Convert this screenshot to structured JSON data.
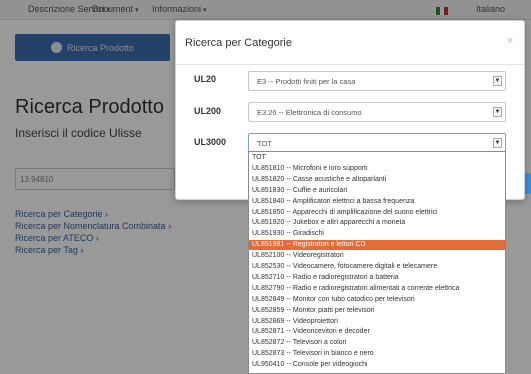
{
  "navbar": {
    "menu_items": [
      "Descrizione Servizi",
      "Document",
      "Informazioni"
    ],
    "language_label": "Italiano",
    "flag_colors": [
      "#2e8b3a",
      "#ffffff",
      "#cf2f2f"
    ]
  },
  "background": {
    "search_button_label": "Ricerca Prodotto",
    "page_title": "Ricerca Prodotto",
    "subtitle": "Inserisci il codice Ulisse",
    "input_value": "13.94810",
    "links": [
      "Ricerca per Categorie",
      "Ricerca per Nomenclatura Combinata",
      "Ricerca per ATECO",
      "Ricerca per Tag"
    ]
  },
  "modal": {
    "title": "Ricerca per Categorie",
    "close_glyph": "×",
    "fields": [
      {
        "label": "UL20",
        "value": "E3 -- Prodotti finiti per la casa"
      },
      {
        "label": "UL200",
        "value": "E3.26 -- Elettronica di consumo"
      },
      {
        "label": "UL3000",
        "value": "TOT"
      }
    ]
  },
  "dropdown": {
    "options": [
      "TOT",
      "UL851810 -- Microfoni e loro supporti",
      "UL851820 -- Casse acustiche e altoparlanti",
      "UL851830 -- Cuffie e auricolari",
      "UL851840 -- Amplificatori elettrici a bassa frequenza",
      "UL851850 -- Apparecchi di amplificazione del suono elettrici",
      "UL851920 -- Jukebox e altri apparecchi a moneta",
      "UL851930 -- Giradischi",
      "UL851981 -- Registratori e lettori CD",
      "UL852100 -- Videoregistratori",
      "UL852530 -- Videocamere, fotocamere digitali e telecamere",
      "UL852710 -- Radio e radioregistratori a batteria",
      "UL852790 -- Radio e radioregistratori alimentati a corrente elettrica",
      "UL852849 -- Monitor con tubo catodico per televisori",
      "UL852859 -- Monitor piatti per televisori",
      "UL852869 -- Videoproiettori",
      "UL852871 -- Videoricevitori e decoder",
      "UL852872 -- Televisori a colori",
      "UL852873 -- Televisori in bianco e nero",
      "UL950410 -- Console per videogiochi"
    ],
    "selected_index": 8
  }
}
